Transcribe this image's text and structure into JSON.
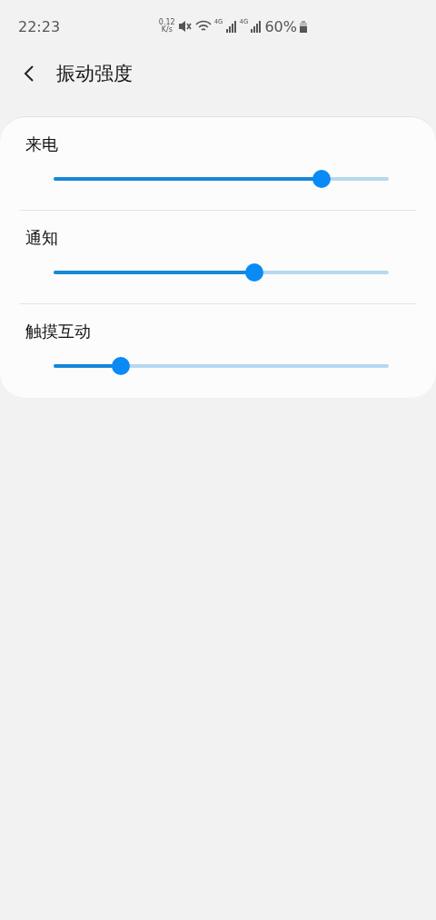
{
  "status_bar": {
    "time": "22:23",
    "net_speed_value": "0.12",
    "net_speed_unit": "K/s",
    "network_label_1": "4G",
    "network_label_2": "4G",
    "battery": "60%"
  },
  "header": {
    "title": "振动强度"
  },
  "sliders": [
    {
      "label": "来电",
      "level": 0.8
    },
    {
      "label": "通知",
      "level": 0.6
    },
    {
      "label": "触摸互动",
      "level": 0.2
    }
  ]
}
